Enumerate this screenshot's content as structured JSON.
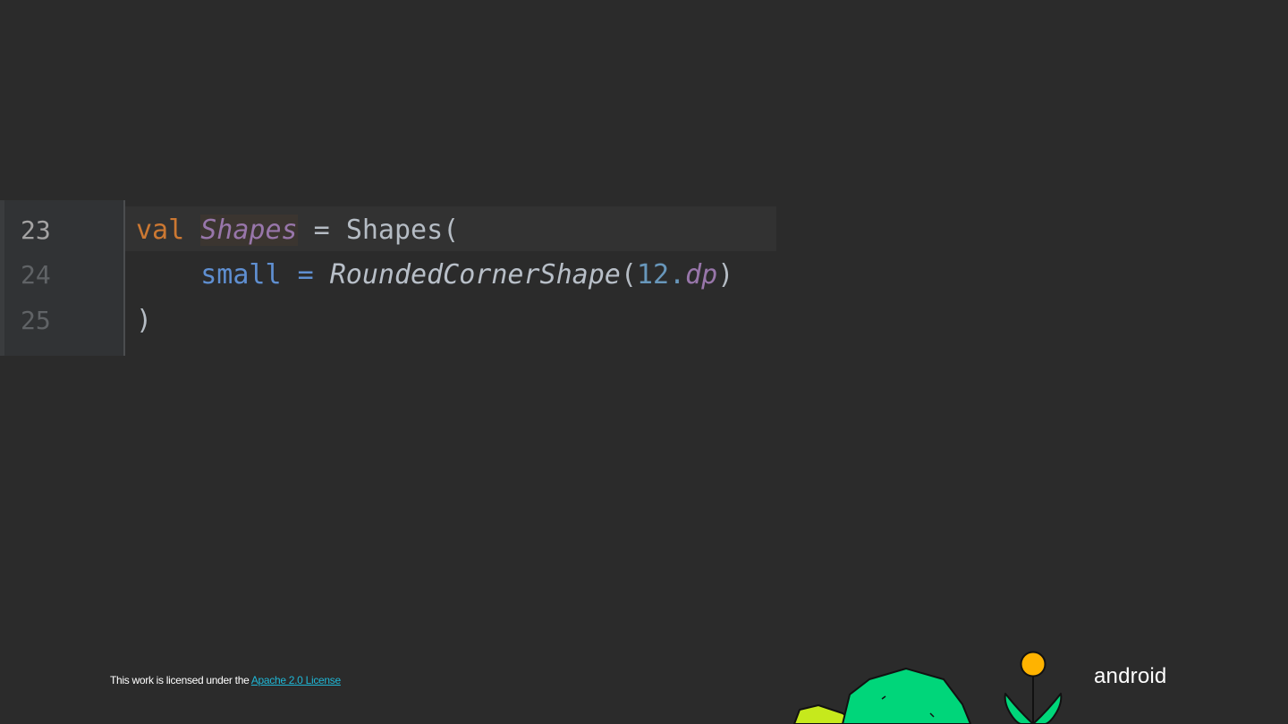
{
  "editor": {
    "lines": [
      {
        "number": "23",
        "tokens": {
          "keyword": "val",
          "property": "Shapes",
          "assign": " = ",
          "call": "Shapes("
        }
      },
      {
        "number": "24",
        "tokens": {
          "param": "small",
          "assign": " = ",
          "function": "RoundedCornerShape",
          "open": "(",
          "number": "12.",
          "extension": "dp",
          "close": ")"
        }
      },
      {
        "number": "25",
        "tokens": {
          "close": ")"
        }
      }
    ]
  },
  "footer": {
    "license_text": "This work is licensed under the ",
    "license_link": "Apache 2.0 License",
    "logo_text": "android"
  },
  "colors": {
    "background": "#2b2b2b",
    "keyword": "#cc7832",
    "property": "#9876aa",
    "number": "#6897bb",
    "named_arg": "#5f8fd1",
    "link": "#1fb7d6"
  },
  "icons": {
    "illustration": "android-plants-illustration"
  }
}
